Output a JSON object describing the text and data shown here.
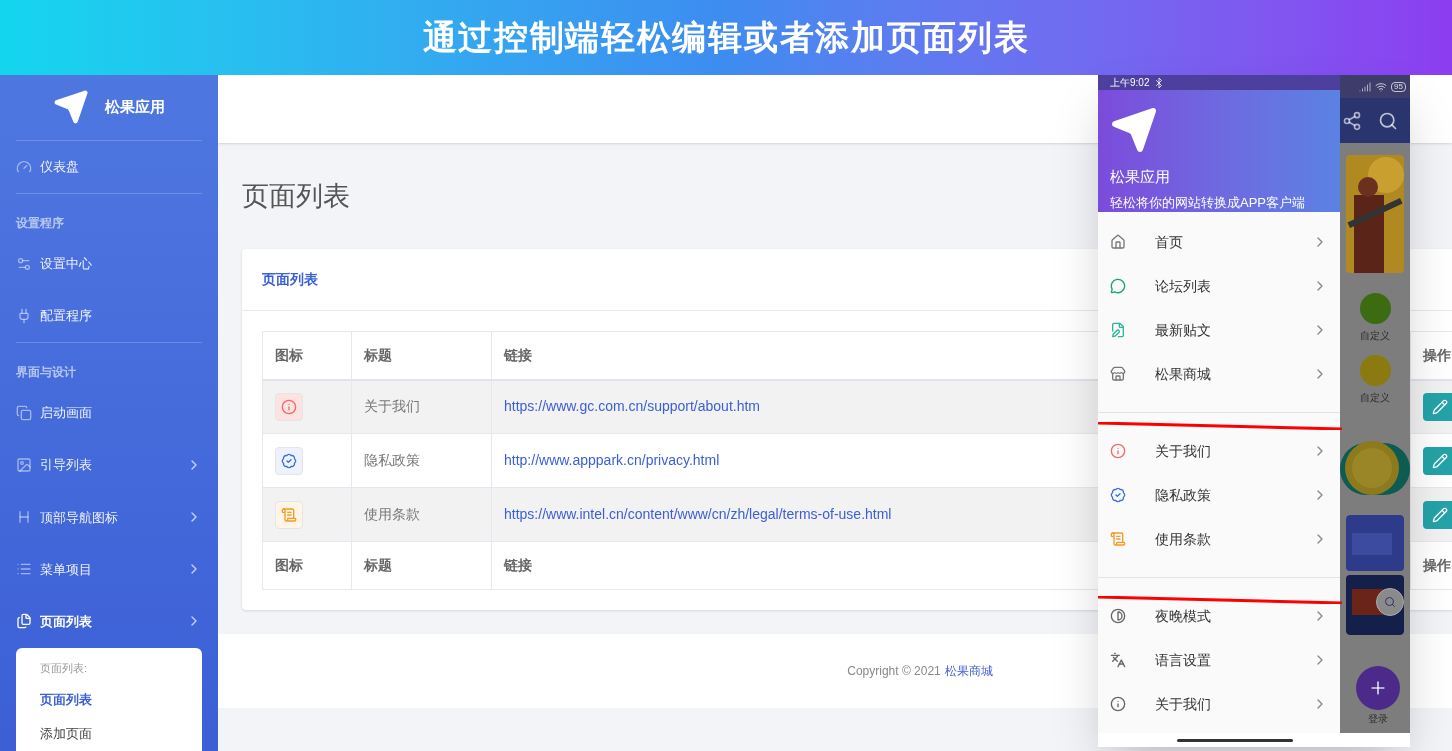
{
  "banner": {
    "title": "通过控制端轻松编辑或者添加页面列表"
  },
  "sidebar": {
    "brand": "松果应用",
    "items": [
      {
        "kind": "link",
        "label": "仪表盘",
        "selected": false,
        "has_submenu": false
      },
      {
        "kind": "heading",
        "label": "设置程序"
      },
      {
        "kind": "link",
        "label": "设置中心",
        "selected": false,
        "has_submenu": false
      },
      {
        "kind": "link",
        "label": "配置程序",
        "selected": false,
        "has_submenu": false
      },
      {
        "kind": "heading",
        "label": "界面与设计"
      },
      {
        "kind": "link",
        "label": "启动画面",
        "selected": false,
        "has_submenu": false
      },
      {
        "kind": "link",
        "label": "引导列表",
        "selected": false,
        "has_submenu": true
      },
      {
        "kind": "link",
        "label": "顶部导航图标",
        "selected": false,
        "has_submenu": true
      },
      {
        "kind": "link",
        "label": "菜单项目",
        "selected": false,
        "has_submenu": true
      },
      {
        "kind": "link",
        "label": "页面列表",
        "selected": true,
        "has_submenu": true
      }
    ],
    "submenu": {
      "title": "页面列表:",
      "items": [
        {
          "label": "页面列表",
          "selected": true
        },
        {
          "label": "添加页面",
          "selected": false
        }
      ]
    }
  },
  "main": {
    "page_title": "页面列表",
    "card_title": "页面列表",
    "columns": [
      "图标",
      "标题",
      "链接",
      "操作"
    ],
    "rows": [
      {
        "title": "关于我们",
        "link": "https://www.gc.com.cn/support/about.htm"
      },
      {
        "title": "隐私政策",
        "link": "http://www.apppark.cn/privacy.html"
      },
      {
        "title": "使用条款",
        "link": "https://www.intel.cn/content/www/cn/zh/legal/terms-of-use.html"
      }
    ],
    "footer_columns": [
      "图标",
      "标题",
      "链接",
      "操作"
    ],
    "copyright": "Copyright © 2021",
    "copyright_link": "松果商城"
  },
  "phone": {
    "time": "上午9:02",
    "battery": "95",
    "app_name": "松果应用",
    "tagline": "轻松将你的网站转换成APP客户端",
    "groups": [
      [
        "首页",
        "论坛列表",
        "最新贴文",
        "松果商城"
      ],
      [
        "关于我们",
        "隐私政策",
        "使用条款"
      ],
      [
        "夜晚模式",
        "语言设置",
        "关于我们"
      ]
    ],
    "background_labels": [
      "自定义",
      "自定义"
    ],
    "login": "登录"
  }
}
